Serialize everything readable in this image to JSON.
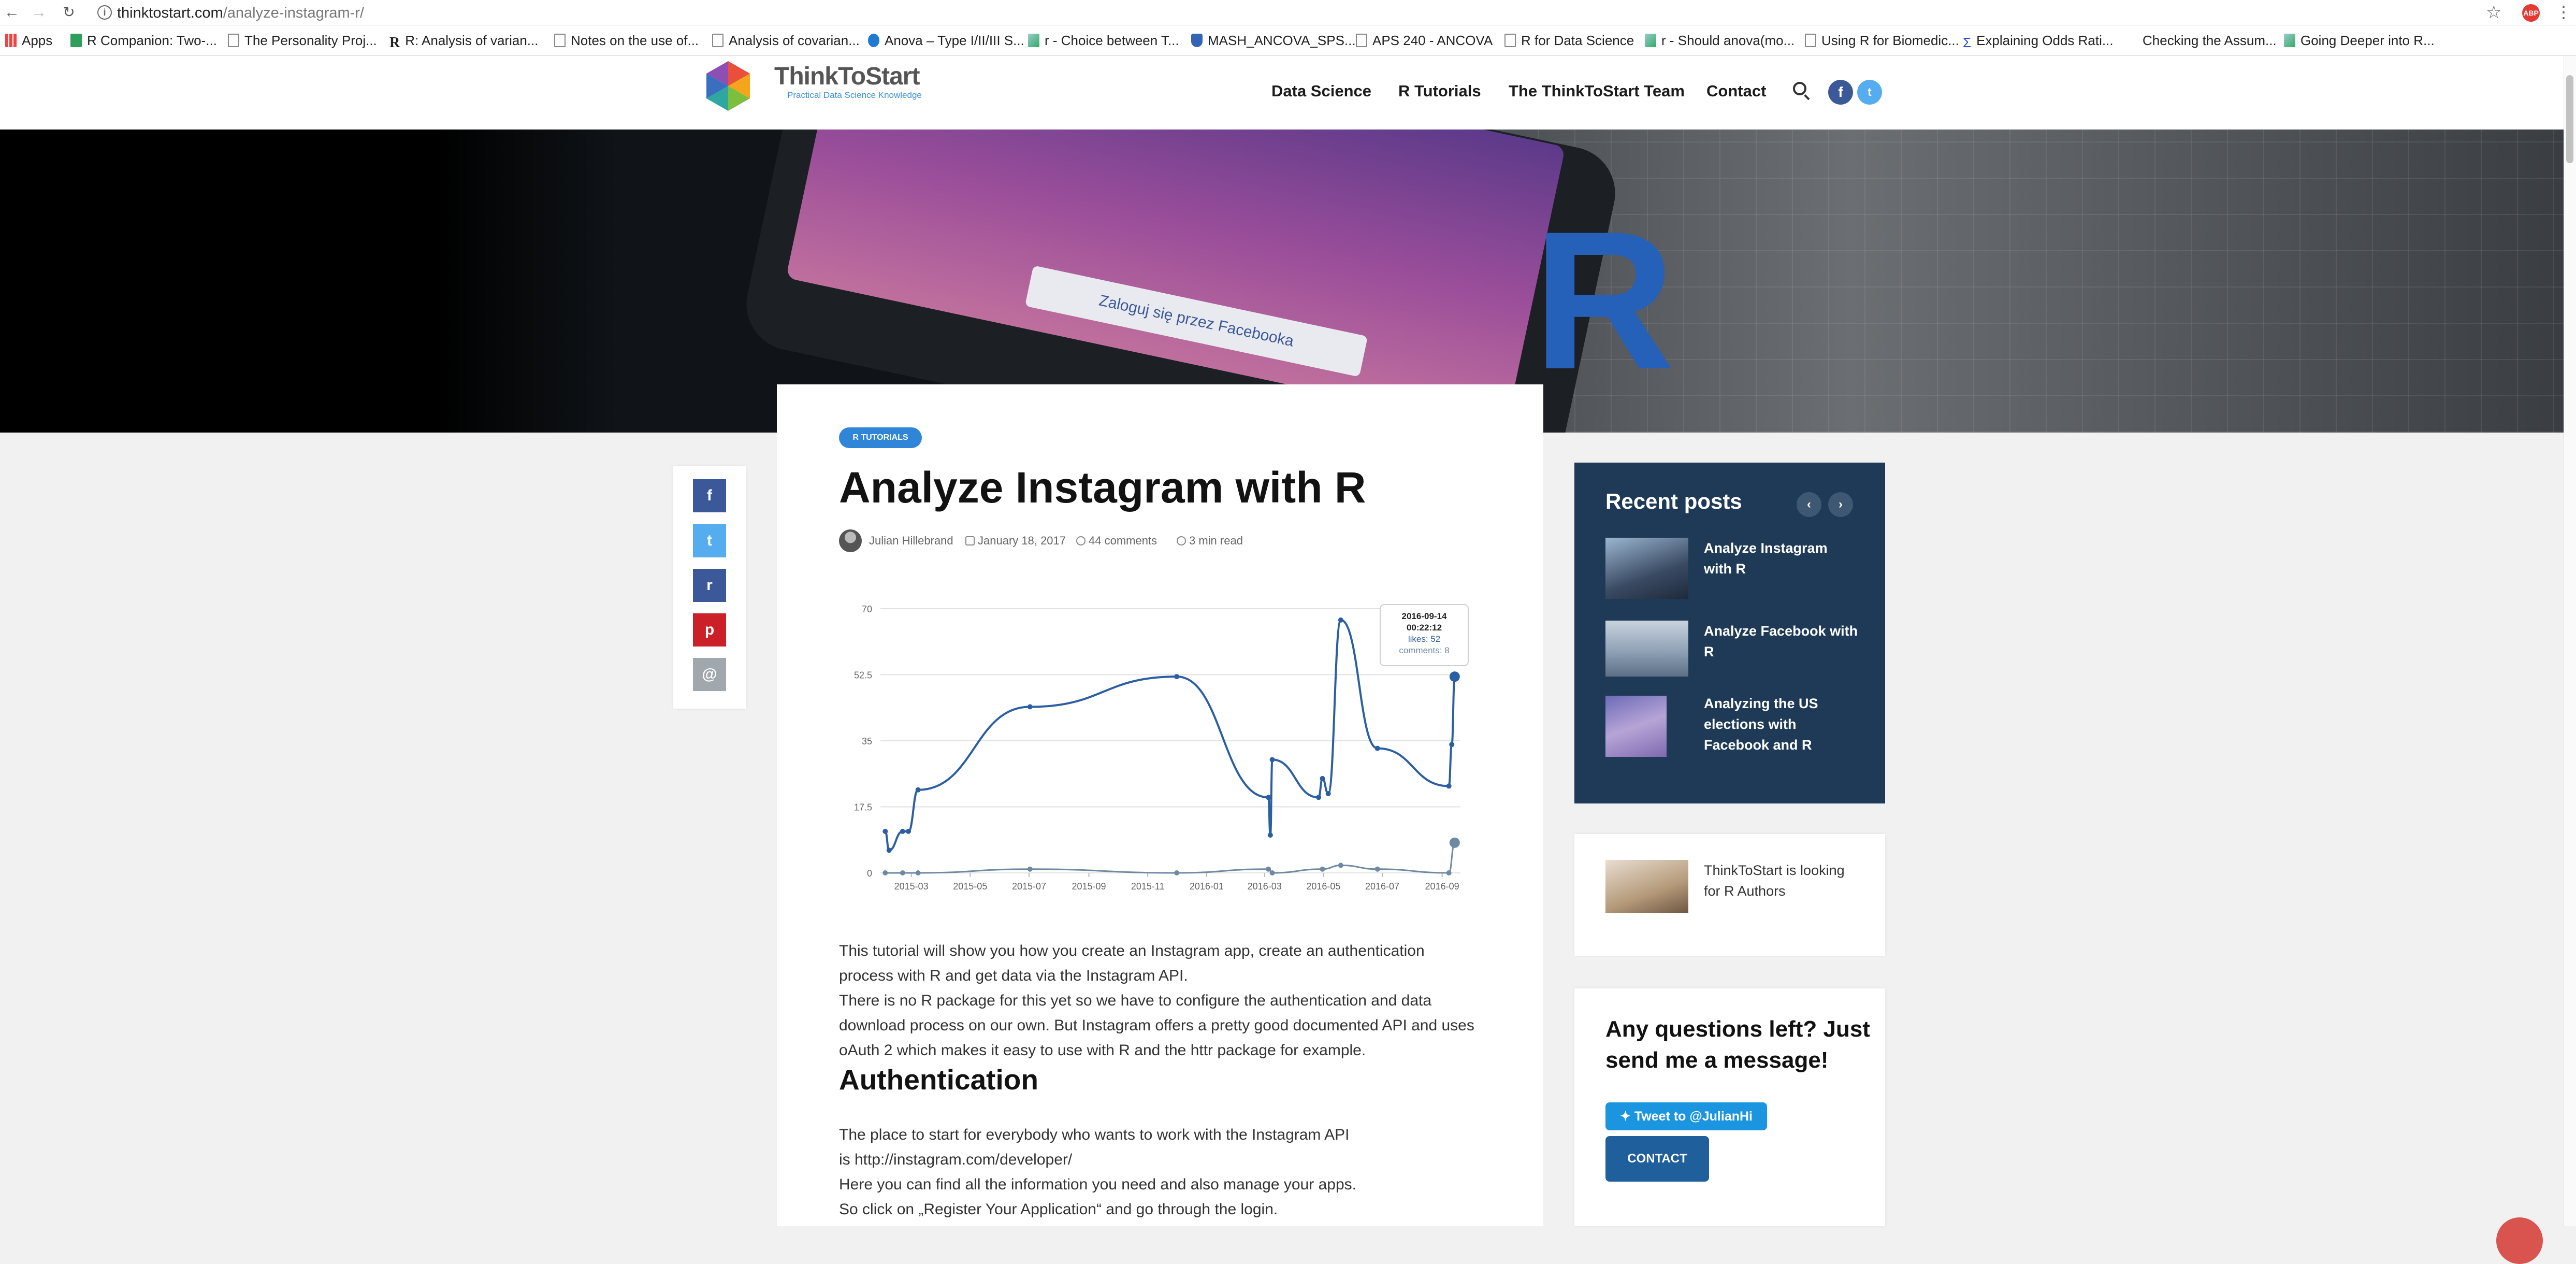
{
  "browser": {
    "url_host": "thinktostart.com",
    "url_path": "/analyze-instagram-r/",
    "bookmarks": [
      {
        "label": "Apps",
        "icon": "apps-grid-icon"
      },
      {
        "label": "R Companion: Two-...",
        "icon": "green-page-icon"
      },
      {
        "label": "The Personality Proj...",
        "icon": "page-icon"
      },
      {
        "label": "R: Analysis of varian...",
        "icon": "r-icon"
      },
      {
        "label": "Notes on the use of...",
        "icon": "page-icon"
      },
      {
        "label": "Analysis of covarian...",
        "icon": "page-icon"
      },
      {
        "label": "Anova – Type I/II/III S...",
        "icon": "wordpress-icon"
      },
      {
        "label": "r - Choice between T...",
        "icon": "stack-icon"
      },
      {
        "label": "MASH_ANCOVA_SPS...",
        "icon": "shield-icon"
      },
      {
        "label": "APS 240 - ANCOVA",
        "icon": "page-icon"
      },
      {
        "label": "R for Data Science",
        "icon": "page-icon"
      },
      {
        "label": "r - Should anova(mo...",
        "icon": "stack-icon"
      },
      {
        "label": "Using R for Biomedic...",
        "icon": "book-icon"
      },
      {
        "label": "Explaining Odds Rati...",
        "icon": "sigma-icon"
      },
      {
        "label": "Checking the Assum...",
        "icon": "none"
      },
      {
        "label": "Going Deeper into R...",
        "icon": "chart-icon"
      }
    ]
  },
  "site": {
    "logo_name": "ThinkToStart",
    "logo_tagline": "Practical Data Science Knowledge",
    "menu": [
      "Data Science",
      "R Tutorials",
      "The ThinkToStart Team",
      "Contact"
    ]
  },
  "hero": {
    "fb_button_text": "Zaloguj się przez Facebooka",
    "r_letter": "R"
  },
  "article": {
    "category": "R TUTORIALS",
    "title": "Analyze Instagram with R",
    "author": "Julian Hillebrand",
    "date": "January 18, 2017",
    "comments": "44 comments",
    "read_time": "3 min read",
    "paragraph1": [
      "This tutorial will show you how you create an Instagram app, create an authentication",
      "process with R and get data via the Instagram API.",
      "There is no R package for this yet so we have to configure the authentication and data",
      "download process on our own. But Instagram offers a pretty good documented API and uses",
      "oAuth 2 which makes it easy to use with R and the httr package for example."
    ],
    "heading_auth": "Authentication",
    "paragraph2": [
      "The place to start for everybody who wants to work with the Instagram API",
      "is http://instagram.com/developer/",
      "Here you can find all the information you need and also manage your apps.",
      "So click on „Register Your Application“ and go through the login."
    ]
  },
  "chart_data": {
    "type": "line",
    "x_ticks": [
      "2015-03",
      "2015-05",
      "2015-07",
      "2015-09",
      "2015-11",
      "2016-01",
      "2016-03",
      "2016-05",
      "2016-07",
      "2016-09"
    ],
    "ylim": [
      0,
      70
    ],
    "y_ticks": [
      "0",
      "17.5",
      "35",
      "52.5",
      "70"
    ],
    "grid": true,
    "series": [
      {
        "name": "likes",
        "color": "#2b5ea2",
        "points": [
          {
            "x": "2015-02-02",
            "y": 11
          },
          {
            "x": "2015-02-06",
            "y": 6
          },
          {
            "x": "2015-02-20",
            "y": 11
          },
          {
            "x": "2015-02-26",
            "y": 11
          },
          {
            "x": "2015-03-08",
            "y": 22
          },
          {
            "x": "2015-07-02",
            "y": 44
          },
          {
            "x": "2015-12-01",
            "y": 52
          },
          {
            "x": "2016-03-05",
            "y": 20
          },
          {
            "x": "2016-03-07",
            "y": 10
          },
          {
            "x": "2016-03-09",
            "y": 30
          },
          {
            "x": "2016-04-26",
            "y": 20
          },
          {
            "x": "2016-04-30",
            "y": 25
          },
          {
            "x": "2016-05-06",
            "y": 21
          },
          {
            "x": "2016-05-19",
            "y": 67
          },
          {
            "x": "2016-06-26",
            "y": 33
          },
          {
            "x": "2016-09-08",
            "y": 23
          },
          {
            "x": "2016-09-11",
            "y": 34
          },
          {
            "x": "2016-09-14",
            "y": 52
          }
        ]
      },
      {
        "name": "comments",
        "color": "#6e8aa3",
        "points": [
          {
            "x": "2015-02-02",
            "y": 0
          },
          {
            "x": "2015-02-20",
            "y": 0
          },
          {
            "x": "2015-03-08",
            "y": 0
          },
          {
            "x": "2015-07-02",
            "y": 1
          },
          {
            "x": "2015-12-01",
            "y": 0
          },
          {
            "x": "2016-03-05",
            "y": 1
          },
          {
            "x": "2016-03-09",
            "y": 0
          },
          {
            "x": "2016-04-30",
            "y": 1
          },
          {
            "x": "2016-05-19",
            "y": 2
          },
          {
            "x": "2016-06-26",
            "y": 1
          },
          {
            "x": "2016-09-08",
            "y": 0
          },
          {
            "x": "2016-09-14",
            "y": 8
          }
        ]
      }
    ],
    "tooltip": {
      "date": "2016-09-14",
      "time": "00:22:12",
      "likes_label": "likes: 52",
      "comments_label": "comments: 8"
    }
  },
  "share": [
    "f",
    "t",
    "r",
    "p",
    "@"
  ],
  "sidebar": {
    "recent_title": "Recent posts",
    "recent_posts": [
      "Analyze Instagram with R",
      "Analyze Facebook with R",
      "Analyzing the US elections with Facebook and R"
    ],
    "authors_post": "ThinkToStart is looking for R Authors",
    "contact_title": "Any questions left? Just send me a message!",
    "tweet_label": "Tweet to @JulianHi",
    "contact_label": "CONTACT"
  },
  "colors": {
    "accent": "#2f86d9",
    "sidebar_bg": "#1e3a57",
    "likes_line": "#2b5ea2",
    "facebook": "#3b5998",
    "twitter": "#55acee",
    "reddit": "#3b5998",
    "pinterest": "#cb2027",
    "email": "#a0a8ae"
  }
}
